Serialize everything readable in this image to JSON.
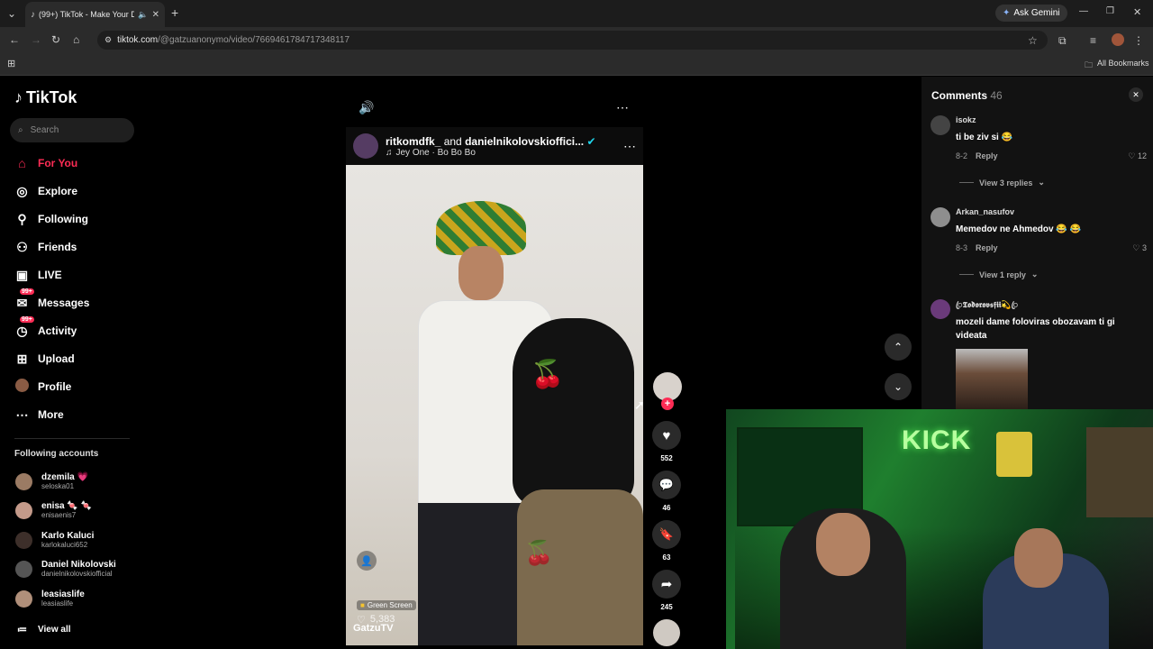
{
  "browser": {
    "tab_title": "(99+) TikTok - Make Your D",
    "url_host": "tiktok.com",
    "url_path": "/@gatzuanonymo/video/7669461784717348117",
    "ask_gemini": "Ask Gemini",
    "bookmarks_label": "All Bookmarks"
  },
  "sidebar": {
    "logo": "TikTok",
    "search_placeholder": "Search",
    "nav": [
      {
        "label": "For You",
        "icon": "home-icon",
        "glyph": "⌂",
        "active": true
      },
      {
        "label": "Explore",
        "icon": "compass-icon",
        "glyph": "◎"
      },
      {
        "label": "Following",
        "icon": "person-icon",
        "glyph": "👤"
      },
      {
        "label": "Friends",
        "icon": "friends-icon",
        "glyph": "👥"
      },
      {
        "label": "LIVE",
        "icon": "live-icon",
        "glyph": "▣"
      },
      {
        "label": "Messages",
        "icon": "messages-icon",
        "glyph": "✉",
        "badge": "99+"
      },
      {
        "label": "Activity",
        "icon": "activity-icon",
        "glyph": "◷",
        "badge": "99+"
      },
      {
        "label": "Upload",
        "icon": "upload-icon",
        "glyph": "⊞"
      },
      {
        "label": "Profile",
        "icon": "avatar",
        "glyph": "●"
      },
      {
        "label": "More",
        "icon": "more-icon",
        "glyph": "⋯"
      }
    ],
    "following_title": "Following accounts",
    "accounts": [
      {
        "name": "dzemila 💗",
        "handle": "seloska01"
      },
      {
        "name": "enisa 🍬 🍬",
        "handle": "enisaenis7"
      },
      {
        "name": "Karlo Kaluci",
        "handle": "karlokaluci652"
      },
      {
        "name": "Daniel Nikolovski",
        "handle": "danielnikolovskiofficial"
      },
      {
        "name": "leasiaslife",
        "handle": "leasiaslife"
      }
    ],
    "view_all": "View all"
  },
  "video": {
    "authors_a": "ritkomdfk_",
    "authors_and": "and",
    "authors_b": "danielnikolovskioffici...",
    "music": "Jey One · Bo Bo Bo",
    "effect": "Green Screen",
    "likes_overlay": "5,383",
    "channel": "GatzuTV"
  },
  "rail": {
    "likes": "552",
    "comments": "46",
    "saves": "63",
    "shares": "245"
  },
  "comments": {
    "title": "Comments",
    "count": "46",
    "items": [
      {
        "user": "isokz",
        "text": "ti be ziv si 😂",
        "date": "8-2",
        "reply": "Reply",
        "likes": "12",
        "view_replies": "View 3 replies"
      },
      {
        "user": "Arkan_nasufov",
        "text": "Memedov ne Ahmedov 😂 😂",
        "date": "8-3",
        "reply": "Reply",
        "likes": "3",
        "view_replies": "View 1 reply"
      },
      {
        "user": "ꦿ𝕿𝖔𝖉𝖔𝖗𝖔𝖛𝖘𝖋𝖎𝖎💫ꦿ",
        "text": "mozeli dame foloviras obozavam ti gi videata"
      }
    ]
  },
  "colors": {
    "accent": "#fe2c55",
    "verified": "#20d5ec"
  }
}
